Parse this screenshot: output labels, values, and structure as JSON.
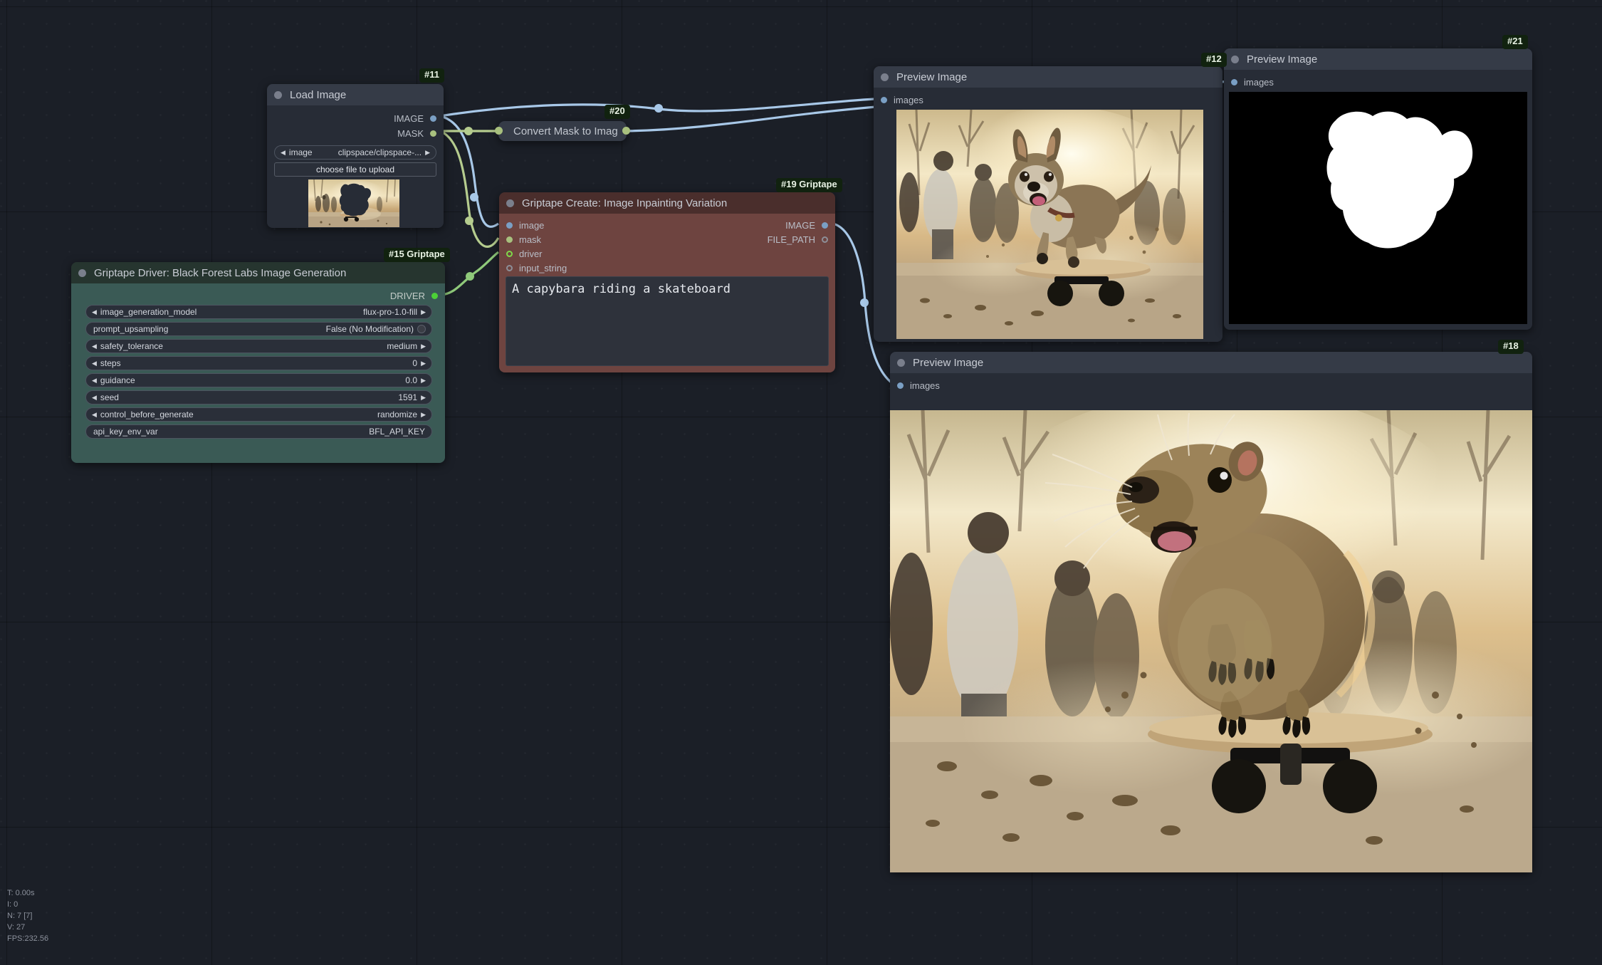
{
  "colors": {
    "canvas_bg": "#1b1f27",
    "node_header": "#353b47",
    "node_body": "#272c36",
    "teal_body": "#3a5a55",
    "teal_header": "#26352f",
    "maroon_body": "#6e4440",
    "maroon_header": "#4a2e2c",
    "badge_bg": "#11220f",
    "link_image": "#a8c8e8",
    "link_mask": "#b5cc8e",
    "link_driver": "#8fc97a",
    "slot_image": "#7a9fc4",
    "slot_mask": "#a8c07e",
    "slot_driver": "#7fd94a"
  },
  "nodes": {
    "load_image": {
      "badge": "#11",
      "title": "Load Image",
      "outputs": [
        {
          "name": "IMAGE",
          "color": "#7a9fc4"
        },
        {
          "name": "MASK",
          "color": "#a8c07e"
        }
      ],
      "widgets": [
        {
          "name": "image",
          "value": "clipspace/clipspace-...",
          "arrows": true
        }
      ],
      "upload_button": "choose file to upload"
    },
    "convert_mask": {
      "badge": "#20",
      "title": "Convert Mask to Imag"
    },
    "griptape_driver": {
      "badge": "#15 Griptape",
      "title": "Griptape Driver: Black Forest Labs Image Generation",
      "outputs": [
        {
          "name": "DRIVER",
          "color": "#7fd94a"
        }
      ],
      "widgets": [
        {
          "name": "image_generation_model",
          "value": "flux-pro-1.0-fill",
          "arrows": true
        },
        {
          "name": "prompt_upsampling",
          "value": "False (No Modification)",
          "arrows": false,
          "toggle": true
        },
        {
          "name": "safety_tolerance",
          "value": "medium",
          "arrows": true
        },
        {
          "name": "steps",
          "value": "0",
          "arrows": true
        },
        {
          "name": "guidance",
          "value": "0.0",
          "arrows": true
        },
        {
          "name": "seed",
          "value": "1591",
          "arrows": true
        },
        {
          "name": "control_before_generate",
          "value": "randomize",
          "arrows": true
        },
        {
          "name": "api_key_env_var",
          "value": "BFL_API_KEY",
          "arrows": false
        }
      ]
    },
    "griptape_create": {
      "badge": "#19 Griptape",
      "title": "Griptape Create: Image Inpainting Variation",
      "inputs": [
        {
          "name": "image",
          "color": "#7a9fc4",
          "style": "solid"
        },
        {
          "name": "mask",
          "color": "#a8c07e",
          "style": "solid"
        },
        {
          "name": "driver",
          "color": "#7fd94a",
          "style": "hollow"
        },
        {
          "name": "input_string",
          "color": "#8d8f98",
          "style": "hollow-grey"
        }
      ],
      "outputs": [
        {
          "name": "IMAGE",
          "color": "#7a9fc4"
        },
        {
          "name": "FILE_PATH",
          "color": "#8d8f98"
        }
      ],
      "prompt_text": "A capybara riding a skateboard"
    },
    "preview_12": {
      "badge": "#12",
      "title": "Preview Image",
      "input": {
        "name": "images",
        "color": "#7a9fc4"
      },
      "image_caption": "dog jumping over skateboard at sunset"
    },
    "preview_21": {
      "badge": "#21",
      "title": "Preview Image",
      "input": {
        "name": "images",
        "color": "#7a9fc4"
      },
      "image_caption": "white mask silhouette on black background"
    },
    "preview_18": {
      "badge": "#18",
      "title": "Preview Image",
      "input": {
        "name": "images",
        "color": "#7a9fc4"
      },
      "image_caption": "capybara riding a skateboard at sunset"
    }
  },
  "stats": {
    "time": "T: 0.00s",
    "iterations": "I: 0",
    "nodes": "N: 7 [7]",
    "vertices": "V: 27",
    "fps": "FPS:232.56"
  }
}
